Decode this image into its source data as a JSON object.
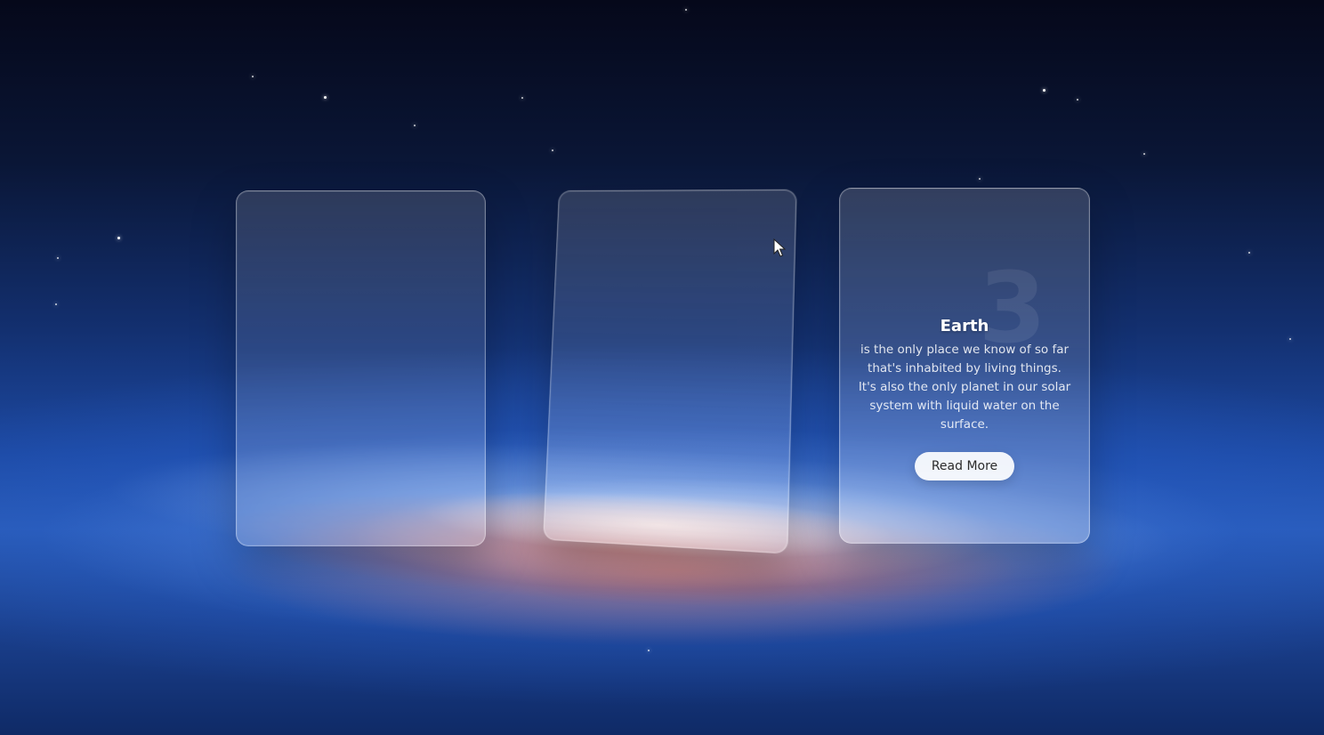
{
  "cards": [
    {
      "id": 1
    },
    {
      "id": 2
    },
    {
      "id": 3,
      "number": "3",
      "title": "Earth",
      "description": "is the only place we know of so far that's inhabited by living things. It's also the only planet in our solar system with liquid water on the surface.",
      "button_label": "Read More"
    }
  ],
  "colors": {
    "space_top": "#05081a",
    "space_mid": "#1d4aa4",
    "nebula_red": "#ce6050",
    "button_bg": "#ffffff",
    "button_text": "#2b2b2b"
  },
  "icons": {
    "cursor": "mouse-pointer-icon"
  }
}
